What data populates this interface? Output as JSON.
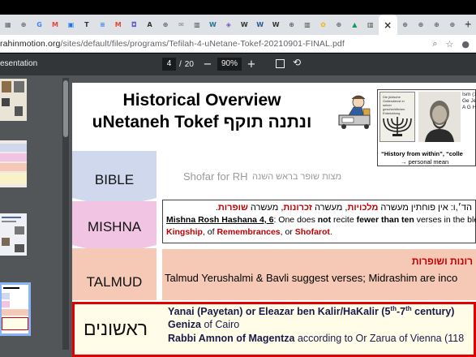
{
  "browser": {
    "tabs": [
      {
        "icon": "grid-icon",
        "glyph": "▦",
        "color": "#5f6368"
      },
      {
        "icon": "globe-icon",
        "glyph": "⊕",
        "color": "#5f6368"
      },
      {
        "icon": "google-icon",
        "glyph": "G",
        "color": "#4285f4"
      },
      {
        "icon": "gmail-icon",
        "glyph": "M",
        "color": "#ea4335"
      },
      {
        "icon": "meet-icon",
        "glyph": "▣",
        "color": "#1a73e8"
      },
      {
        "icon": "text-icon",
        "glyph": "T",
        "color": "#333333"
      },
      {
        "icon": "docs-icon",
        "glyph": "≡",
        "color": "#4285f4"
      },
      {
        "icon": "gmail-icon",
        "glyph": "M",
        "color": "#ea4335"
      },
      {
        "icon": "teams-icon",
        "glyph": "◘",
        "color": "#5b5fc7"
      },
      {
        "icon": "font-icon",
        "glyph": "A",
        "color": "#333333"
      },
      {
        "icon": "globe-icon",
        "glyph": "⊕",
        "color": "#5f6368"
      },
      {
        "icon": "mail-icon",
        "glyph": "✉",
        "color": "#888888"
      },
      {
        "icon": "calendar-icon",
        "glyph": "▥",
        "color": "#444444"
      },
      {
        "icon": "wordpress-icon",
        "glyph": "W",
        "color": "#21759b"
      },
      {
        "icon": "shield-icon",
        "glyph": "◈",
        "color": "#7e57c2"
      },
      {
        "icon": "wikipedia-icon",
        "glyph": "W",
        "color": "#333333"
      },
      {
        "icon": "wordpress-icon",
        "glyph": "W",
        "color": "#2b579a"
      },
      {
        "icon": "wikipedia-icon",
        "glyph": "W",
        "color": "#333333"
      },
      {
        "icon": "globe-icon",
        "glyph": "⊕",
        "color": "#5f6368"
      },
      {
        "icon": "calendar-icon",
        "glyph": "▥",
        "color": "#444444"
      },
      {
        "icon": "photos-icon",
        "glyph": "✿",
        "color": "#f4b400"
      },
      {
        "icon": "globe-icon",
        "glyph": "⊕",
        "color": "#5f6368"
      },
      {
        "icon": "drive-icon",
        "glyph": "▲",
        "color": "#0f9d58"
      },
      {
        "icon": "calendar-icon",
        "glyph": "▥",
        "color": "#444444"
      }
    ],
    "active_tab_close": "×",
    "after_tabs": [
      {
        "icon": "globe-icon",
        "glyph": "⊕",
        "color": "#5f6368"
      },
      {
        "icon": "globe-icon",
        "glyph": "⊕",
        "color": "#5f6368"
      },
      {
        "icon": "globe-icon",
        "glyph": "⊕",
        "color": "#5f6368"
      },
      {
        "icon": "globe-icon",
        "glyph": "⊕",
        "color": "#5f6368"
      }
    ],
    "new_tab": "+",
    "url_host": "rahinmotion.org",
    "url_path": "/sites/default/files/programs/Tefilah-4-uNetane-Tokef-20210901-FINAL.pdf"
  },
  "pdf_toolbar": {
    "title": "esentation",
    "page_current": "4",
    "page_total": "20",
    "zoom": "90%",
    "zoom_out": "−",
    "zoom_in": "+"
  },
  "slide": {
    "title_line1": "Historical Overview",
    "title_line2": "uNetaneh Tokef ונתנה תוקף",
    "book_side_text": "Ism (18 Ge Jev A G His",
    "book_caption1": "“History from within”, “colle",
    "book_caption2": "→ personal mean",
    "book_cover_text": "Die jüdische Gottesdienst in seiner geschichtlichen Entwicklung",
    "rows": {
      "bible": "BIBLE",
      "mishna": "MISHNA",
      "talmud": "TALMUD",
      "rishonim": "ראשונים"
    },
    "shofar_en": "Shofar for RH",
    "shofar_he": "מצות שופר בראש השנה",
    "mishna_he_prefix": "הד׳,ו: אין פוחתין מעשרה ",
    "mishna_he_malchuyot": "מלכויות",
    "mishna_he_mid1": ", מעשרה ",
    "mishna_he_zichronot": "זכרונות",
    "mishna_he_mid2": ", מעשרה ",
    "mishna_he_shofarot": "שופרות",
    "mishna_he_end": ".",
    "mishna_ref": "Mishna Rosh Hashana 4, 6",
    "mishna_en1_a": ": One does ",
    "mishna_en1_not": "not",
    "mishna_en1_b": " recite ",
    "mishna_en1_fewer": "fewer than ten",
    "mishna_en1_c": " verses in the ble",
    "mishna_en2_kingship": "Kingship",
    "mishna_en2_a": ", of ",
    "mishna_en2_remembrances": "Remembrances",
    "mishna_en2_b": ", or ",
    "mishna_en2_shofarot": "Shofarot",
    "mishna_en2_c": ".",
    "talmud_he": "רונות ושופרות",
    "talmud_en": "Talmud Yerushalmi & Bavli suggest verses; Midrashim are inco",
    "r1_a": "Yanai (Payetan) or Eleazar ben Kalir/HaKalir (5",
    "r1_sup1": "th",
    "r1_b": "-7",
    "r1_sup2": "th",
    "r1_c": " century)",
    "r2_bold": "Geniza",
    "r2_rest": " of Cairo",
    "r3_bold": "Rabbi Amnon of Magentza",
    "r3_rest": " according to Or Zarua of Vienna (118"
  }
}
